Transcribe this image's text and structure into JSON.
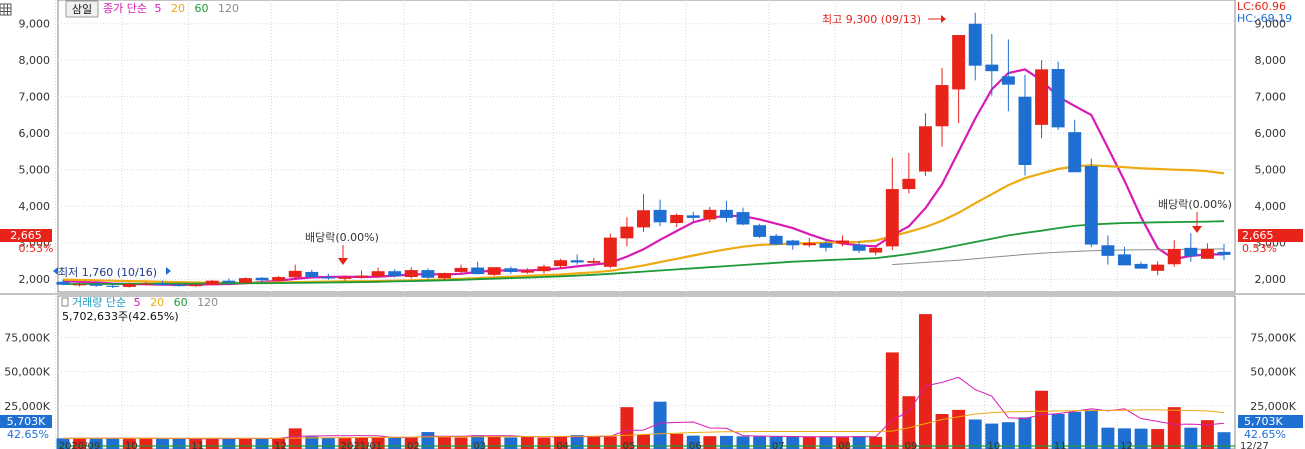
{
  "toolbar": {
    "stock_button_label": "삼일",
    "price_legend": {
      "name": "종가 단순",
      "periods": [
        "5",
        "20",
        "60",
        "120"
      ]
    },
    "volume_legend": {
      "name": "거래량 단순",
      "periods": [
        "5",
        "20",
        "60",
        "120"
      ]
    },
    "volume_value_text": "5,702,633주(42.65%)"
  },
  "colors": {
    "up": "#e8231a",
    "down": "#1f6fd2",
    "ma5": "#d81bb4",
    "ma20": "#eeaa10",
    "ma60": "#1d9a3a",
    "ma120": "#8c8c8c",
    "current_tag": "#e8231a",
    "volume_tag": "#1f6fd2"
  },
  "price_axis": {
    "ticks": [
      "2,000",
      "3,000",
      "4,000",
      "5,000",
      "6,000",
      "7,000",
      "8,000",
      "9,000"
    ],
    "tick_values": [
      2000,
      3000,
      4000,
      5000,
      6000,
      7000,
      8000,
      9000
    ],
    "min": 1650,
    "max": 9650
  },
  "volume_axis": {
    "ticks": [
      "25,000K",
      "50,000K",
      "75,000K"
    ],
    "tick_values": [
      25000,
      50000,
      75000
    ],
    "max": 95000
  },
  "right_info": {
    "lc": "LC:60.96",
    "hc": "HC:-69.19"
  },
  "current_price": {
    "value": 2665,
    "price_text": "2,665",
    "change_text": "0.53%"
  },
  "current_volume": {
    "value": 5703,
    "volume_text": "5,703K",
    "pct_text": "42.65%"
  },
  "annotations": {
    "high": {
      "text": "최고 9,300 (09/13)",
      "value": 9300
    },
    "low": {
      "text": "최저 1,760 (10/16)",
      "value": 1760
    },
    "dividend_1": {
      "text": "배당락(0.00%)"
    },
    "dividend_2": {
      "text": "배당락(0.00%)"
    }
  },
  "x_axis": {
    "labels": [
      "2020/09",
      "10",
      "11",
      "12",
      "2021/01",
      "02",
      "03",
      "04",
      "05",
      "06",
      "07",
      "08",
      "09",
      "10",
      "11",
      "12"
    ],
    "right_label": "12/27"
  },
  "chart_data": {
    "type": "candlestick",
    "period": "weekly",
    "x_labels": [
      "2020/09",
      "10",
      "11",
      "12",
      "2021/01",
      "02",
      "03",
      "04",
      "05",
      "06",
      "07",
      "08",
      "09",
      "10",
      "11",
      "12"
    ],
    "candles": [
      {
        "o": 1930,
        "h": 1990,
        "l": 1840,
        "c": 1850
      },
      {
        "o": 1850,
        "h": 1900,
        "l": 1800,
        "c": 1860
      },
      {
        "o": 1860,
        "h": 1930,
        "l": 1790,
        "c": 1820
      },
      {
        "o": 1820,
        "h": 1870,
        "l": 1760,
        "c": 1790
      },
      {
        "o": 1790,
        "h": 1900,
        "l": 1770,
        "c": 1870
      },
      {
        "o": 1870,
        "h": 1920,
        "l": 1840,
        "c": 1880
      },
      {
        "o": 1880,
        "h": 1960,
        "l": 1840,
        "c": 1840
      },
      {
        "o": 1840,
        "h": 1880,
        "l": 1800,
        "c": 1810
      },
      {
        "o": 1810,
        "h": 1880,
        "l": 1790,
        "c": 1850
      },
      {
        "o": 1850,
        "h": 1980,
        "l": 1830,
        "c": 1960
      },
      {
        "o": 1960,
        "h": 2020,
        "l": 1900,
        "c": 1910
      },
      {
        "o": 1900,
        "h": 2050,
        "l": 1880,
        "c": 2030
      },
      {
        "o": 2040,
        "h": 2060,
        "l": 1920,
        "c": 1970
      },
      {
        "o": 1970,
        "h": 2090,
        "l": 1940,
        "c": 2060
      },
      {
        "o": 2050,
        "h": 2400,
        "l": 2000,
        "c": 2230
      },
      {
        "o": 2200,
        "h": 2260,
        "l": 2050,
        "c": 2060
      },
      {
        "o": 2060,
        "h": 2150,
        "l": 1990,
        "c": 2020
      },
      {
        "o": 2010,
        "h": 2100,
        "l": 1960,
        "c": 2060
      },
      {
        "o": 2050,
        "h": 2240,
        "l": 2020,
        "c": 2100
      },
      {
        "o": 2080,
        "h": 2320,
        "l": 2040,
        "c": 2220
      },
      {
        "o": 2220,
        "h": 2270,
        "l": 2050,
        "c": 2080
      },
      {
        "o": 2060,
        "h": 2330,
        "l": 2020,
        "c": 2250
      },
      {
        "o": 2250,
        "h": 2300,
        "l": 2000,
        "c": 2040
      },
      {
        "o": 2030,
        "h": 2180,
        "l": 1980,
        "c": 2170
      },
      {
        "o": 2200,
        "h": 2400,
        "l": 2120,
        "c": 2310
      },
      {
        "o": 2320,
        "h": 2480,
        "l": 2130,
        "c": 2140
      },
      {
        "o": 2120,
        "h": 2300,
        "l": 2090,
        "c": 2330
      },
      {
        "o": 2300,
        "h": 2350,
        "l": 2150,
        "c": 2200
      },
      {
        "o": 2180,
        "h": 2300,
        "l": 2150,
        "c": 2240
      },
      {
        "o": 2220,
        "h": 2400,
        "l": 2150,
        "c": 2350
      },
      {
        "o": 2360,
        "h": 2560,
        "l": 2290,
        "c": 2520
      },
      {
        "o": 2520,
        "h": 2680,
        "l": 2400,
        "c": 2460
      },
      {
        "o": 2450,
        "h": 2580,
        "l": 2400,
        "c": 2500
      },
      {
        "o": 2340,
        "h": 3250,
        "l": 2300,
        "c": 3140
      },
      {
        "o": 3120,
        "h": 3700,
        "l": 2900,
        "c": 3440
      },
      {
        "o": 3420,
        "h": 4330,
        "l": 3300,
        "c": 3890
      },
      {
        "o": 3900,
        "h": 4180,
        "l": 3450,
        "c": 3560
      },
      {
        "o": 3540,
        "h": 3800,
        "l": 3430,
        "c": 3760
      },
      {
        "o": 3750,
        "h": 3850,
        "l": 3540,
        "c": 3680
      },
      {
        "o": 3640,
        "h": 3980,
        "l": 3560,
        "c": 3900
      },
      {
        "o": 3900,
        "h": 4150,
        "l": 3560,
        "c": 3680
      },
      {
        "o": 3840,
        "h": 3960,
        "l": 3480,
        "c": 3500
      },
      {
        "o": 3480,
        "h": 3520,
        "l": 3130,
        "c": 3160
      },
      {
        "o": 3190,
        "h": 3240,
        "l": 2930,
        "c": 2950
      },
      {
        "o": 3060,
        "h": 3080,
        "l": 2810,
        "c": 2930
      },
      {
        "o": 2930,
        "h": 3130,
        "l": 2880,
        "c": 2990
      },
      {
        "o": 2990,
        "h": 3100,
        "l": 2760,
        "c": 2860
      },
      {
        "o": 2980,
        "h": 3200,
        "l": 2900,
        "c": 3060
      },
      {
        "o": 2950,
        "h": 3050,
        "l": 2720,
        "c": 2780
      },
      {
        "o": 2730,
        "h": 2880,
        "l": 2660,
        "c": 2860
      },
      {
        "o": 2900,
        "h": 5330,
        "l": 2800,
        "c": 4470
      },
      {
        "o": 4470,
        "h": 5460,
        "l": 4350,
        "c": 4750
      },
      {
        "o": 4950,
        "h": 6550,
        "l": 4830,
        "c": 6190
      },
      {
        "o": 6190,
        "h": 7790,
        "l": 5630,
        "c": 7320
      },
      {
        "o": 7200,
        "h": 8070,
        "l": 6280,
        "c": 8690
      },
      {
        "o": 9000,
        "h": 9300,
        "l": 7450,
        "c": 7850
      },
      {
        "o": 7880,
        "h": 8720,
        "l": 7030,
        "c": 7700
      },
      {
        "o": 7560,
        "h": 8570,
        "l": 6600,
        "c": 7330
      },
      {
        "o": 7000,
        "h": 7600,
        "l": 4840,
        "c": 5130
      },
      {
        "o": 6230,
        "h": 8000,
        "l": 5860,
        "c": 7750
      },
      {
        "o": 7760,
        "h": 7960,
        "l": 6090,
        "c": 6160
      },
      {
        "o": 6030,
        "h": 6370,
        "l": 4950,
        "c": 4930
      },
      {
        "o": 5100,
        "h": 5300,
        "l": 2880,
        "c": 2950
      },
      {
        "o": 2930,
        "h": 3200,
        "l": 2400,
        "c": 2640
      },
      {
        "o": 2680,
        "h": 2890,
        "l": 2430,
        "c": 2380
      },
      {
        "o": 2420,
        "h": 2480,
        "l": 2290,
        "c": 2290
      },
      {
        "o": 2230,
        "h": 2490,
        "l": 2110,
        "c": 2400
      },
      {
        "o": 2410,
        "h": 3070,
        "l": 2340,
        "c": 2830
      },
      {
        "o": 2860,
        "h": 3260,
        "l": 2480,
        "c": 2630
      },
      {
        "o": 2560,
        "h": 2980,
        "l": 2560,
        "c": 2830
      },
      {
        "o": 2750,
        "h": 2960,
        "l": 2520,
        "c": 2665
      }
    ],
    "ma_series": [
      {
        "name": "5",
        "values": [
          1950,
          1930,
          1910,
          1880,
          1870,
          1860,
          1850,
          1845,
          1850,
          1860,
          1870,
          1890,
          1920,
          1960,
          2010,
          2050,
          2060,
          2070,
          2060,
          2070,
          2100,
          2130,
          2140,
          2130,
          2150,
          2200,
          2240,
          2240,
          2240,
          2260,
          2300,
          2350,
          2400,
          2450,
          2620,
          2820,
          3080,
          3320,
          3560,
          3680,
          3740,
          3730,
          3640,
          3520,
          3400,
          3230,
          3080,
          2980,
          2930,
          2900,
          3200,
          3450,
          3950,
          4600,
          5500,
          6400,
          7200,
          7650,
          7750,
          7450,
          7000,
          6750,
          6500,
          5600,
          4700,
          3700,
          2850,
          2550,
          2640,
          2680,
          2680
        ]
      },
      {
        "name": "20",
        "values": [
          1990,
          1980,
          1970,
          1960,
          1950,
          1940,
          1930,
          1920,
          1910,
          1905,
          1900,
          1900,
          1905,
          1910,
          1920,
          1930,
          1935,
          1940,
          1945,
          1950,
          1960,
          1970,
          1980,
          1995,
          2010,
          2030,
          2050,
          2070,
          2090,
          2110,
          2130,
          2160,
          2190,
          2230,
          2300,
          2380,
          2470,
          2560,
          2650,
          2740,
          2820,
          2890,
          2940,
          2960,
          2980,
          2990,
          3000,
          3010,
          3020,
          3060,
          3180,
          3300,
          3430,
          3600,
          3820,
          4080,
          4330,
          4580,
          4770,
          4900,
          5020,
          5090,
          5120,
          5100,
          5070,
          5040,
          5020,
          5000,
          4990,
          4960,
          4900
        ]
      },
      {
        "name": "60",
        "values": [
          1870,
          1870,
          1870,
          1870,
          1875,
          1875,
          1880,
          1880,
          1880,
          1885,
          1885,
          1890,
          1890,
          1895,
          1900,
          1905,
          1910,
          1915,
          1920,
          1930,
          1940,
          1950,
          1960,
          1970,
          1985,
          2000,
          2015,
          2030,
          2045,
          2060,
          2080,
          2100,
          2120,
          2150,
          2180,
          2210,
          2240,
          2270,
          2300,
          2330,
          2360,
          2390,
          2420,
          2450,
          2480,
          2500,
          2520,
          2540,
          2560,
          2580,
          2630,
          2690,
          2760,
          2840,
          2930,
          3020,
          3110,
          3200,
          3270,
          3330,
          3400,
          3460,
          3500,
          3520,
          3540,
          3550,
          3560,
          3565,
          3570,
          3580,
          3590
        ]
      },
      {
        "name": "120",
        "values": [
          null,
          null,
          null,
          null,
          null,
          null,
          null,
          null,
          null,
          null,
          null,
          null,
          null,
          null,
          null,
          null,
          null,
          null,
          null,
          null,
          null,
          null,
          null,
          null,
          null,
          null,
          null,
          null,
          null,
          null,
          null,
          null,
          null,
          null,
          null,
          null,
          null,
          null,
          null,
          null,
          null,
          null,
          null,
          null,
          null,
          null,
          null,
          null,
          null,
          null,
          2400,
          2430,
          2460,
          2490,
          2520,
          2560,
          2600,
          2640,
          2680,
          2710,
          2740,
          2760,
          2780,
          2790,
          2800,
          2805,
          2810,
          2815,
          2820,
          2825,
          2830
        ]
      }
    ],
    "volume": [
      1200,
      1500,
      1300,
      1400,
      1100,
      1000,
      900,
      800,
      1000,
      1200,
      1000,
      1100,
      1300,
      1200,
      8500,
      2500,
      1800,
      1500,
      1700,
      2000,
      1600,
      2200,
      5800,
      2100,
      1800,
      3500,
      2400,
      1900,
      2200,
      1700,
      2500,
      3600,
      2800,
      2600,
      24000,
      4000,
      28000,
      4500,
      3200,
      2800,
      3000,
      2700,
      2500,
      2400,
      2200,
      2300,
      2600,
      2100,
      2800,
      2300,
      64000,
      32000,
      92000,
      19000,
      22000,
      15000,
      12000,
      13000,
      16500,
      36000,
      19000,
      20500,
      22000,
      9000,
      8500,
      8300,
      8000,
      24000,
      9000,
      14500,
      5703
    ],
    "volume_ma": [
      {
        "name": "5",
        "values": [
          1200,
          1300,
          1300,
          1300,
          1300,
          1260,
          1140,
          1100,
          980,
          980,
          1020,
          1060,
          1120,
          1160,
          2620,
          2900,
          3060,
          3140,
          3180,
          3100,
          1720,
          1780,
          2680,
          2720,
          2700,
          3100,
          3120,
          3120,
          2360,
          2340,
          2340,
          2380,
          2540,
          2640,
          7100,
          7200,
          12400,
          12800,
          13140,
          8800,
          8540,
          3200,
          2840,
          2680,
          2540,
          2420,
          2400,
          2320,
          2400,
          2420,
          14660,
          20760,
          39560,
          42080,
          45800,
          36800,
          32000,
          16200,
          15700,
          18500,
          19300,
          20900,
          22800,
          21300,
          22800,
          15700,
          13600,
          11400,
          11600,
          11000,
          12240
        ]
      },
      {
        "name": "20",
        "values": [
          1200,
          1300,
          1300,
          1300,
          1300,
          1300,
          1300,
          1300,
          1300,
          1300,
          1300,
          1300,
          1300,
          1300,
          1400,
          1500,
          1600,
          1700,
          1800,
          1900,
          2000,
          2100,
          2300,
          2400,
          2400,
          2400,
          2500,
          2500,
          2500,
          2500,
          2600,
          2700,
          2800,
          3000,
          3500,
          4000,
          4500,
          5000,
          5500,
          5800,
          6000,
          6100,
          6200,
          6200,
          6200,
          6200,
          6200,
          6200,
          6200,
          6200,
          6500,
          9000,
          12000,
          15000,
          17000,
          19000,
          20000,
          20500,
          20800,
          21000,
          21200,
          21400,
          21500,
          21600,
          21800,
          22000,
          22000,
          21800,
          21500,
          21300,
          20000
        ]
      }
    ]
  }
}
